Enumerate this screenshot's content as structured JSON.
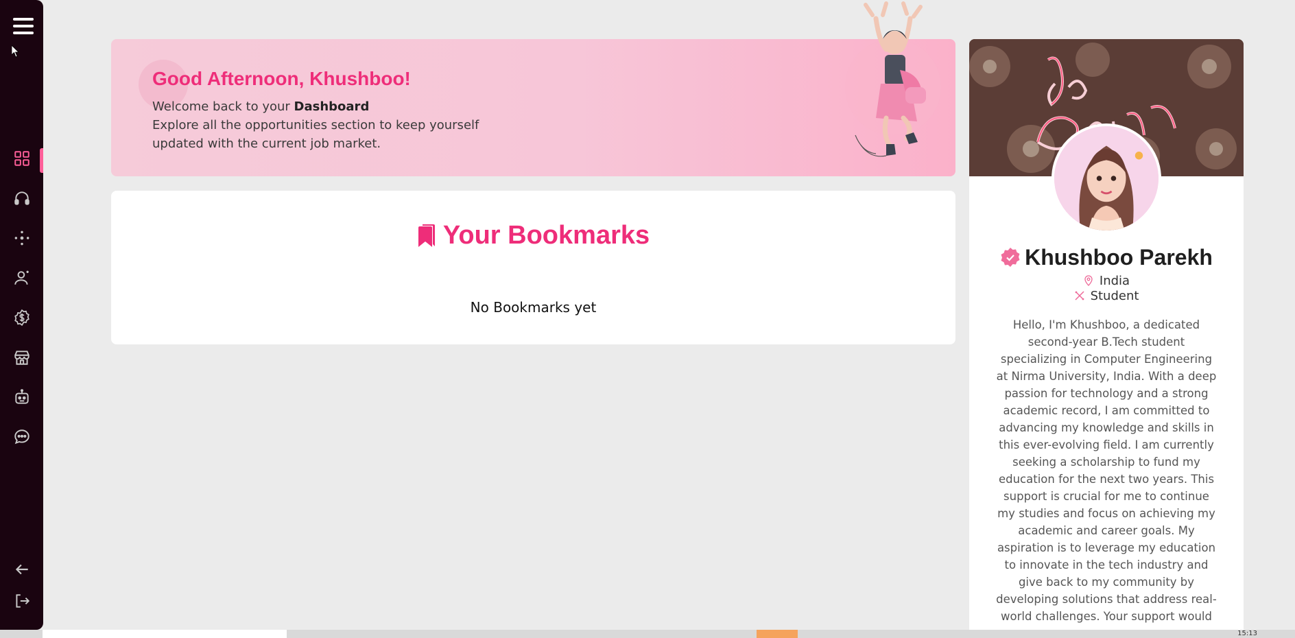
{
  "sidebar": {
    "items": [
      {
        "name": "dashboard",
        "icon": "grid-icon"
      },
      {
        "name": "support",
        "icon": "headphones-icon"
      },
      {
        "name": "network",
        "icon": "network-icon"
      },
      {
        "name": "profile",
        "icon": "user-icon"
      },
      {
        "name": "scholarships",
        "icon": "dollar-icon"
      },
      {
        "name": "store",
        "icon": "store-icon"
      },
      {
        "name": "chatbot",
        "icon": "robot-icon"
      },
      {
        "name": "messages",
        "icon": "chat-icon"
      }
    ],
    "bottom": [
      {
        "name": "back",
        "icon": "arrow-left-icon"
      },
      {
        "name": "logout",
        "icon": "logout-icon"
      }
    ],
    "active_color": "#ff5f99"
  },
  "banner": {
    "greeting": "Good Afternoon, Khushboo!",
    "welcome_prefix": "Welcome back to your ",
    "welcome_bold": "Dashboard",
    "description": "Explore all the opportunities section to keep yourself updated with the current job market."
  },
  "bookmarks": {
    "title": "Your Bookmarks",
    "empty_text": "No Bookmarks yet"
  },
  "profile": {
    "name": "Khushboo Parekh",
    "location": "India",
    "role": "Student",
    "bio": "Hello, I'm Khushboo, a dedicated second-year B.Tech student specializing in Computer Engineering at Nirma University, India. With a deep passion for technology and a strong academic record, I am committed to advancing my knowledge and skills in this ever-evolving field. I am currently seeking a scholarship to fund my education for the next two years. This support is crucial for me to continue my studies and focus on achieving my academic and career goals. My aspiration is to leverage my education to innovate in the tech industry and give back to my community by developing solutions that address real-world challenges. Your support would"
  },
  "colors": {
    "accent": "#ee2d79",
    "sidebar_bg": "#1a0410",
    "background": "#ebebeb"
  },
  "taskbar": {
    "time": "15:13"
  }
}
